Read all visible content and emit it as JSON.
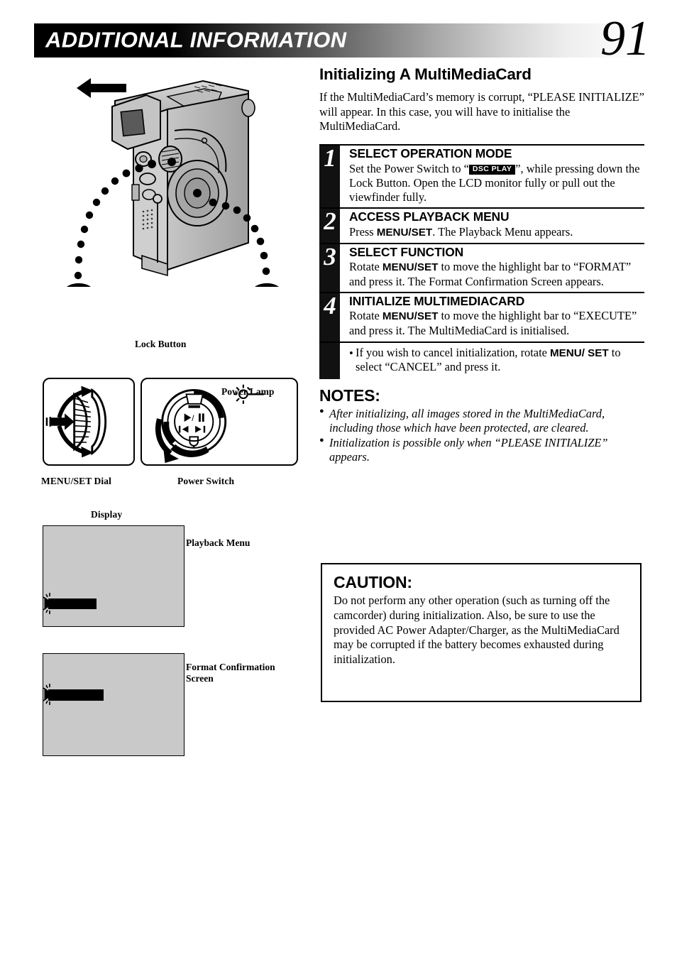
{
  "header": {
    "title": "ADDITIONAL INFORMATION",
    "page_number": "91"
  },
  "section": {
    "title": "Initializing A MultiMediaCard",
    "intro": "If the MultiMediaCard’s memory is corrupt, “PLEASE INITIALIZE” will appear. In this case, you will have to initialise the MultiMediaCard."
  },
  "steps": [
    {
      "number": "1",
      "heading": "SELECT OPERATION MODE",
      "body_before": "Set the Power Switch to “",
      "badge": "DSC PLAY",
      "body_after": "”, while pressing down the Lock Button. Open the LCD monitor fully or pull out the viewfinder fully."
    },
    {
      "number": "2",
      "heading": "ACCESS PLAYBACK MENU",
      "body_before": "Press ",
      "bold": "MENU/SET",
      "body_after": ". The Playback Menu appears."
    },
    {
      "number": "3",
      "heading": "SELECT FUNCTION",
      "body_before": "Rotate ",
      "bold": "MENU/SET",
      "body_after": " to move the highlight bar to “FORMAT” and press it. The Format Confirmation Screen appears."
    },
    {
      "number": "4",
      "heading": "INITIALIZE MULTIMEDIACARD",
      "body_before": "Rotate ",
      "bold": "MENU/SET",
      "body_after": " to move the highlight bar to “EXECUTE” and press it. The MultiMediaCard is initialised."
    }
  ],
  "step_note": {
    "bullet": "•",
    "text_before": "If you wish to cancel initialization, rotate ",
    "bold": "MENU/ SET",
    "text_after": " to select “CANCEL” and press it."
  },
  "notes": {
    "title": "NOTES:",
    "items": [
      "After initializing, all images stored in the MultiMediaCard, including those which have been protected, are cleared.",
      "Initialization is possible only when “PLEASE INITIALIZE” appears."
    ]
  },
  "caution": {
    "title": "CAUTION:",
    "text": "Do not perform any other operation (such as turning off the camcorder) during initialization. Also, be sure to use the provided AC Power Adapter/Charger, as the MultiMediaCard may be corrupted if the battery becomes exhausted during initialization."
  },
  "figures": {
    "lock_button_label": "Lock Button",
    "menuset_dial_caption": "MENU/SET Dial",
    "power_switch_caption": "Power Switch",
    "power_lamp_label": "Power Lamp",
    "display_caption": "Display",
    "playback_menu_label": "Playback Menu",
    "format_screen_label": "Format Confirmation Screen"
  },
  "colors": {
    "screen_gray": "#c9c9c9",
    "bar_black": "#111111",
    "ink": "#000000"
  }
}
